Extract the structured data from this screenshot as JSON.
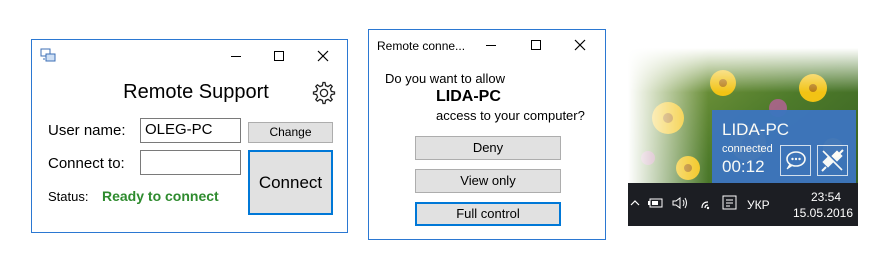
{
  "remote_support": {
    "title": "Remote Support",
    "user_name_label": "User name:",
    "user_name_value": "OLEG-PC",
    "change_label": "Change",
    "connect_to_label": "Connect to:",
    "connect_to_value": "",
    "connect_label": "Connect",
    "status_label": "Status:",
    "status_value": "Ready to connect",
    "status_color": "#2e8b2e"
  },
  "dialog": {
    "title": "Remote conne...",
    "question": "Do you want to allow",
    "computer_name": "LIDA-PC",
    "question_suffix": "access to your computer?",
    "deny_label": "Deny",
    "view_only_label": "View only",
    "full_control_label": "Full control"
  },
  "notification": {
    "computer_name": "LIDA-PC",
    "status": "connected",
    "timer": "00:12"
  },
  "taskbar": {
    "language": "УКР",
    "time": "23:54",
    "date": "15.05.2016"
  },
  "colors": {
    "accent": "#0078d7",
    "notification_bg": "#3d75be",
    "taskbar_bg": "#1c1e23"
  }
}
